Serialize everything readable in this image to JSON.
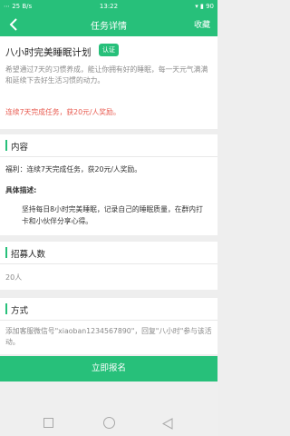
{
  "status_bar": {
    "left": "⋯ 25 B/s",
    "time": "13:22",
    "right": "▾ ▮ 90"
  },
  "nav": {
    "title": "任务详情",
    "action": "收藏"
  },
  "task": {
    "title": "八小时完美睡眠计划",
    "badge": "认证",
    "description": "希望通过7天的习惯养成，能让你拥有好的睡眠，每一天元气满满和延续下去好生活习惯的动力。",
    "reward_highlight": "连续7天完成任务，获20元/人奖励。"
  },
  "content_section": {
    "heading": "内容",
    "benefit": "福利：连续7天完成任务，获20元/人奖励。",
    "detail_label": "具体描述:",
    "detail_body": "坚持每日8小时完美睡眠，记录自己的睡眠质量，在群内打卡和小伙伴分享心得。"
  },
  "recruit_section": {
    "heading": "招募人数",
    "count": "20人"
  },
  "method_section": {
    "heading": "方式",
    "text": "添加客服微信号\"xiaoban1234567890\"，回复\"八小时\"参与该活动。"
  },
  "signup_button": "立即报名",
  "colors": {
    "accent": "#27c07a",
    "highlight": "#e85a4f"
  }
}
